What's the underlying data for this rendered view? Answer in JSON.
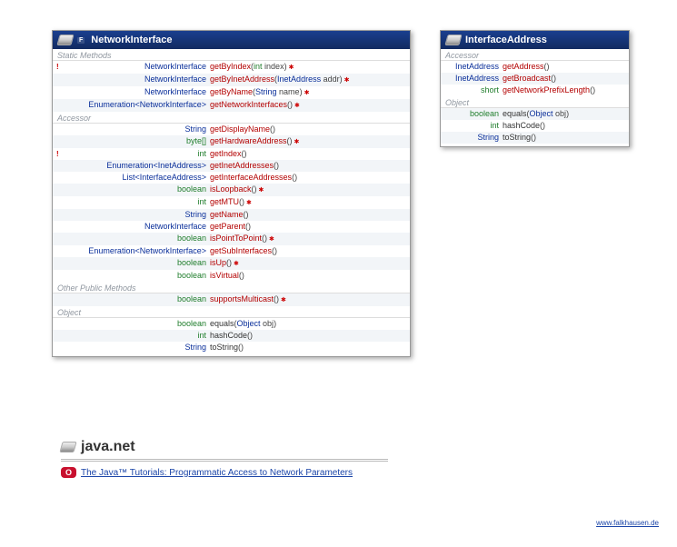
{
  "package": "java.net",
  "tutorial": {
    "badge": "O",
    "text": "The Java™ Tutorials: Programmatic Access to Network Parameters"
  },
  "site": "www.falkhausen.de",
  "boxes": {
    "network": {
      "title": "NetworkInterface",
      "badge": "F",
      "groups": [
        {
          "label": "Static Methods",
          "rows": [
            {
              "flag": "!",
              "rtype": "NetworkInterface",
              "rkind": "ref",
              "method": "getByIndex",
              "params": [
                {
                  "type": "int",
                  "kind": "prim",
                  "name": "index"
                }
              ],
              "throws": true
            },
            {
              "flag": "",
              "rtype": "NetworkInterface",
              "rkind": "ref",
              "method": "getByInetAddress",
              "params": [
                {
                  "type": "InetAddress",
                  "kind": "ref",
                  "name": "addr"
                }
              ],
              "throws": true
            },
            {
              "flag": "",
              "rtype": "NetworkInterface",
              "rkind": "ref",
              "method": "getByName",
              "params": [
                {
                  "type": "String",
                  "kind": "ref",
                  "name": "name"
                }
              ],
              "throws": true
            },
            {
              "flag": "",
              "rtype": "Enumeration<NetworkInterface>",
              "rkind": "ref",
              "method": "getNetworkInterfaces",
              "params": [],
              "throws": true
            }
          ]
        },
        {
          "label": "Accessor",
          "rows": [
            {
              "flag": "",
              "rtype": "String",
              "rkind": "ref",
              "method": "getDisplayName",
              "params": [],
              "throws": false
            },
            {
              "flag": "",
              "rtype": "byte[]",
              "rkind": "prim",
              "method": "getHardwareAddress",
              "params": [],
              "throws": true
            },
            {
              "flag": "!",
              "rtype": "int",
              "rkind": "prim",
              "method": "getIndex",
              "params": [],
              "throws": false
            },
            {
              "flag": "",
              "rtype": "Enumeration<InetAddress>",
              "rkind": "ref",
              "method": "getInetAddresses",
              "params": [],
              "throws": false
            },
            {
              "flag": "",
              "rtype": "List<InterfaceAddress>",
              "rkind": "ref",
              "method": "getInterfaceAddresses",
              "params": [],
              "throws": false
            },
            {
              "flag": "",
              "rtype": "boolean",
              "rkind": "prim",
              "method": "isLoopback",
              "params": [],
              "throws": true
            },
            {
              "flag": "",
              "rtype": "int",
              "rkind": "prim",
              "method": "getMTU",
              "params": [],
              "throws": true
            },
            {
              "flag": "",
              "rtype": "String",
              "rkind": "ref",
              "method": "getName",
              "params": [],
              "throws": false
            },
            {
              "flag": "",
              "rtype": "NetworkInterface",
              "rkind": "ref",
              "method": "getParent",
              "params": [],
              "throws": false
            },
            {
              "flag": "",
              "rtype": "boolean",
              "rkind": "prim",
              "method": "isPointToPoint",
              "params": [],
              "throws": true
            },
            {
              "flag": "",
              "rtype": "Enumeration<NetworkInterface>",
              "rkind": "ref",
              "method": "getSubInterfaces",
              "params": [],
              "throws": false
            },
            {
              "flag": "",
              "rtype": "boolean",
              "rkind": "prim",
              "method": "isUp",
              "params": [],
              "throws": true
            },
            {
              "flag": "",
              "rtype": "boolean",
              "rkind": "prim",
              "method": "isVirtual",
              "params": [],
              "throws": false
            }
          ]
        },
        {
          "label": "Other Public Methods",
          "rows": [
            {
              "flag": "",
              "rtype": "boolean",
              "rkind": "prim",
              "method": "supportsMulticast",
              "params": [],
              "throws": true
            }
          ]
        },
        {
          "label": "Object",
          "rows": [
            {
              "flag": "",
              "rtype": "boolean",
              "rkind": "prim",
              "method": "equals",
              "mkind": "obj",
              "params": [
                {
                  "type": "Object",
                  "kind": "ref",
                  "name": "obj"
                }
              ],
              "throws": false
            },
            {
              "flag": "",
              "rtype": "int",
              "rkind": "prim",
              "method": "hashCode",
              "mkind": "obj",
              "params": [],
              "throws": false
            },
            {
              "flag": "",
              "rtype": "String",
              "rkind": "ref",
              "method": "toString",
              "mkind": "obj",
              "params": [],
              "throws": false
            }
          ]
        }
      ]
    },
    "interface": {
      "title": "InterfaceAddress",
      "groups": [
        {
          "label": "Accessor",
          "rows": [
            {
              "flag": "",
              "rtype": "InetAddress",
              "rkind": "ref",
              "method": "getAddress",
              "params": [],
              "throws": false
            },
            {
              "flag": "",
              "rtype": "InetAddress",
              "rkind": "ref",
              "method": "getBroadcast",
              "params": [],
              "throws": false
            },
            {
              "flag": "",
              "rtype": "short",
              "rkind": "prim",
              "method": "getNetworkPrefixLength",
              "params": [],
              "throws": false
            }
          ]
        },
        {
          "label": "Object",
          "rows": [
            {
              "flag": "",
              "rtype": "boolean",
              "rkind": "prim",
              "method": "equals",
              "mkind": "obj",
              "params": [
                {
                  "type": "Object",
                  "kind": "ref",
                  "name": "obj"
                }
              ],
              "throws": false
            },
            {
              "flag": "",
              "rtype": "int",
              "rkind": "prim",
              "method": "hashCode",
              "mkind": "obj",
              "params": [],
              "throws": false
            },
            {
              "flag": "",
              "rtype": "String",
              "rkind": "ref",
              "method": "toString",
              "mkind": "obj",
              "params": [],
              "throws": false
            }
          ]
        }
      ]
    }
  }
}
